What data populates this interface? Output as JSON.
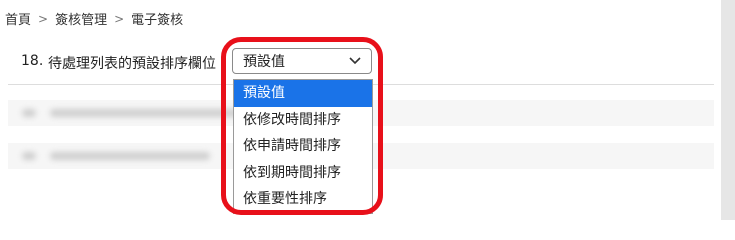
{
  "breadcrumb": {
    "items": [
      "首頁",
      "簽核管理",
      "電子簽核"
    ],
    "separator": ">"
  },
  "setting": {
    "number": "18.",
    "label": "待處理列表的預設排序欄位",
    "selected_value": "預設值"
  },
  "dropdown": {
    "options": [
      "預設值",
      "依修改時間排序",
      "依申請時間排序",
      "依到期時間排序",
      "依重要性排序"
    ],
    "selected_index": 0
  },
  "colors": {
    "selected_option_bg": "#1a73e8",
    "highlight_ring": "#e8101a"
  }
}
